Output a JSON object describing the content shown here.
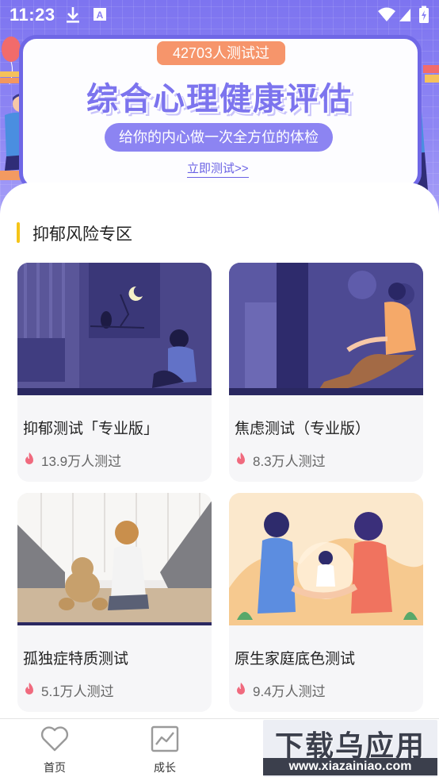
{
  "status_bar": {
    "time": "11:23"
  },
  "banner": {
    "tested_count": "42703人测试过",
    "title": "综合心理健康评估",
    "subtitle": "给你的内心做一次全方位的体检",
    "cta": "立即测试>>"
  },
  "section": {
    "title": "抑郁风险专区"
  },
  "cards": [
    {
      "title": "抑郁测试「专业版」",
      "stat": "13.9万人测过",
      "image": "boy-at-night-window-illustration"
    },
    {
      "title": "焦虑测试（专业版）",
      "stat": "8.3万人测过",
      "image": "man-sitting-on-floor-illustration"
    },
    {
      "title": "孤独症特质测试",
      "stat": "5.1万人测过",
      "image": "girl-with-teddy-bear-photo"
    },
    {
      "title": "原生家庭底色测试",
      "stat": "9.4万人测过",
      "image": "parents-holding-child-illustration"
    }
  ],
  "bottom_nav": [
    {
      "label": "首页",
      "icon": "heart-icon"
    },
    {
      "label": "成长",
      "icon": "chart-icon"
    }
  ],
  "watermark": {
    "top": "下载乌应用",
    "bottom": "www.xiazainiao.com"
  },
  "colors": {
    "banner_purple": "#7d74f0",
    "badge_orange": "#f6956b",
    "section_accent": "#f5c418",
    "flame": "#f06a7e"
  }
}
